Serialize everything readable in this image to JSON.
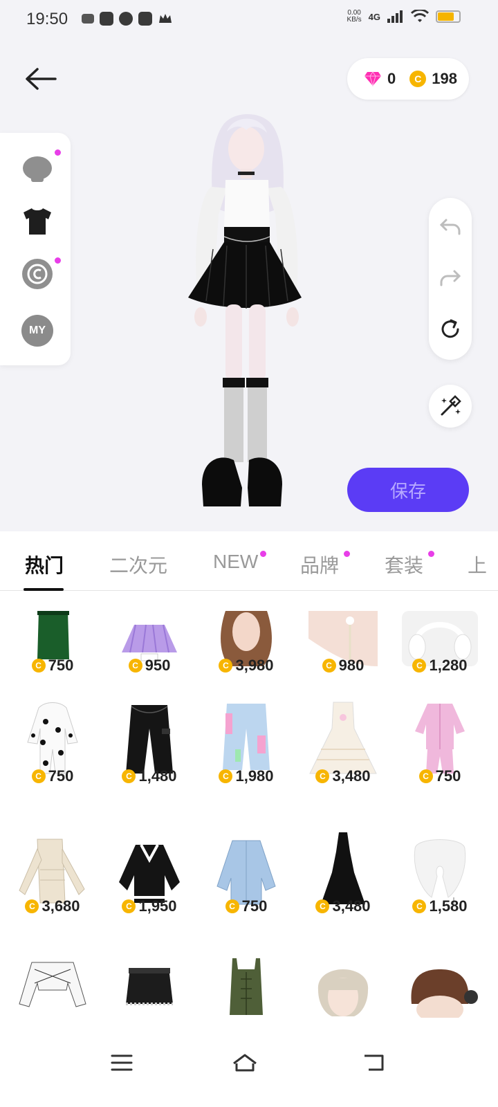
{
  "status_bar": {
    "time": "19:50",
    "net_speed_value": "0.00",
    "net_speed_unit": "KB/s",
    "network": "4G",
    "battery_level": 0.75
  },
  "header": {
    "diamond_count": "0",
    "coin_count": "198",
    "coin_symbol": "C"
  },
  "left_categories": [
    {
      "icon": "head-icon",
      "has_dot": true
    },
    {
      "icon": "tshirt-icon",
      "has_dot": false
    },
    {
      "icon": "copyright-icon",
      "has_dot": true
    },
    {
      "icon": "my-icon",
      "label": "MY",
      "has_dot": false
    }
  ],
  "tools": {
    "undo": "undo-icon",
    "redo": "redo-icon",
    "reset": "reset-icon",
    "magic": "magic-wand-icon"
  },
  "save_label": "保存",
  "tabs": [
    {
      "label": "热门",
      "active": true,
      "has_dot": false
    },
    {
      "label": "二次元",
      "active": false,
      "has_dot": false
    },
    {
      "label": "NEW",
      "active": false,
      "has_dot": true
    },
    {
      "label": "品牌",
      "active": false,
      "has_dot": true
    },
    {
      "label": "套装",
      "active": false,
      "has_dot": true
    },
    {
      "label": "上",
      "active": false,
      "has_dot": false
    }
  ],
  "items": [
    {
      "price": "750",
      "kind": "green-skirt"
    },
    {
      "price": "950",
      "kind": "purple-pleated-skirt"
    },
    {
      "price": "3,980",
      "kind": "brown-long-hair"
    },
    {
      "price": "980",
      "kind": "pearl-earring"
    },
    {
      "price": "1,280",
      "kind": "white-headphones"
    },
    {
      "price": "750",
      "kind": "dalmatian-onesie"
    },
    {
      "price": "1,480",
      "kind": "black-flare-pants"
    },
    {
      "price": "1,980",
      "kind": "pastel-denim-jeans"
    },
    {
      "price": "3,480",
      "kind": "white-ball-gown"
    },
    {
      "price": "750",
      "kind": "pink-pajama-set"
    },
    {
      "price": "3,680",
      "kind": "beige-cutout-outfit"
    },
    {
      "price": "1,950",
      "kind": "black-varsity-sweater"
    },
    {
      "price": "750",
      "kind": "light-blue-coat"
    },
    {
      "price": "3,480",
      "kind": "black-halter-gown"
    },
    {
      "price": "1,580",
      "kind": "white-fur-scarf"
    },
    {
      "price": "",
      "kind": "white-lace-crop-top"
    },
    {
      "price": "",
      "kind": "black-leather-miniskirt"
    },
    {
      "price": "",
      "kind": "olive-corset-top"
    },
    {
      "price": "",
      "kind": "platinum-bob-hair"
    },
    {
      "price": "",
      "kind": "brown-updo-hair"
    }
  ],
  "colors": {
    "accent": "#5b3cf5",
    "coin": "#f7b500",
    "notification_dot": "#e83ee8"
  }
}
